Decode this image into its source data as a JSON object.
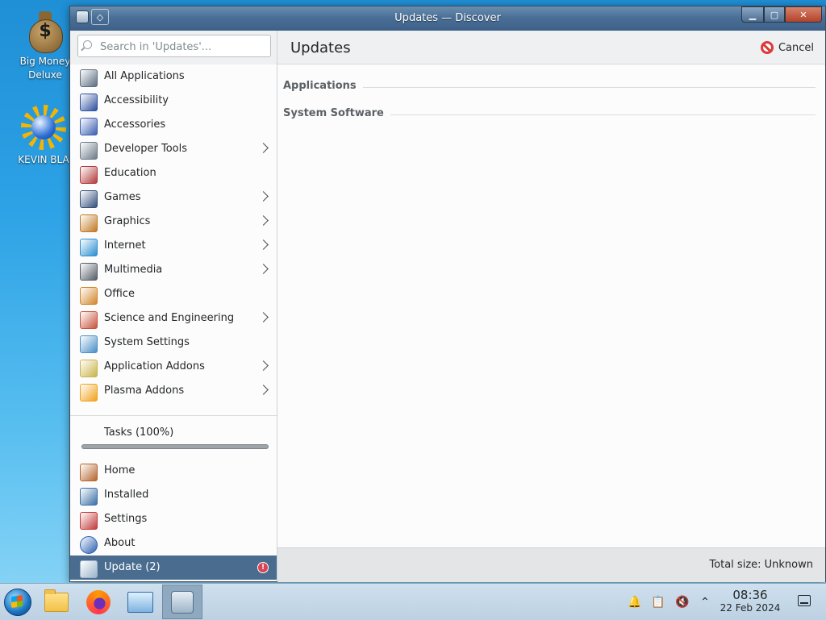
{
  "desktop": {
    "icons": [
      {
        "label": "Big Money\nDeluxe",
        "label_line1": "Big Money",
        "label_line2": "Deluxe"
      },
      {
        "label": "KEVIN BLA"
      }
    ]
  },
  "window": {
    "title": "Updates — Discover",
    "buttons": {
      "minimize": "▁",
      "maximize": "▢",
      "close": "✕"
    }
  },
  "sidebar": {
    "search_placeholder": "Search in 'Updates'...",
    "categories": [
      {
        "label": "All Applications",
        "icon": "all-applications-icon",
        "color": "#5b6e80",
        "submenu": false
      },
      {
        "label": "Accessibility",
        "icon": "accessibility-icon",
        "color": "#2d4f9e",
        "submenu": false
      },
      {
        "label": "Accessories",
        "icon": "accessories-icon",
        "color": "#3a5fb0",
        "submenu": false
      },
      {
        "label": "Developer Tools",
        "icon": "developer-tools-icon",
        "color": "#6c7a87",
        "submenu": true
      },
      {
        "label": "Education",
        "icon": "education-icon",
        "color": "#b23b3b",
        "submenu": false
      },
      {
        "label": "Games",
        "icon": "games-icon",
        "color": "#33507a",
        "submenu": true
      },
      {
        "label": "Graphics",
        "icon": "graphics-icon",
        "color": "#c07a24",
        "submenu": true
      },
      {
        "label": "Internet",
        "icon": "internet-icon",
        "color": "#2a8fd0",
        "submenu": true
      },
      {
        "label": "Multimedia",
        "icon": "multimedia-icon",
        "color": "#555d66",
        "submenu": true
      },
      {
        "label": "Office",
        "icon": "office-icon",
        "color": "#d1872c",
        "submenu": false
      },
      {
        "label": "Science and Engineering",
        "icon": "science-icon",
        "color": "#c7543c",
        "submenu": true
      },
      {
        "label": "System Settings",
        "icon": "system-settings-icon",
        "color": "#4a8fc7",
        "submenu": false
      },
      {
        "label": "Application Addons",
        "icon": "application-addons-icon",
        "color": "#c9b44a",
        "submenu": true
      },
      {
        "label": "Plasma Addons",
        "icon": "plasma-addons-icon",
        "color": "#f0a21b",
        "submenu": true
      }
    ],
    "tasks": {
      "label": "Tasks (100%)",
      "progress": 100
    },
    "nav": [
      {
        "label": "Home",
        "icon": "home-icon",
        "color": "#b5652e"
      },
      {
        "label": "Installed",
        "icon": "installed-icon",
        "color": "#3b6fa6"
      },
      {
        "label": "Settings",
        "icon": "settings-icon",
        "color": "#c23b3b"
      },
      {
        "label": "About",
        "icon": "about-icon",
        "color": "#2a5fb0"
      },
      {
        "label": "Update (2)",
        "icon": "update-icon",
        "color": "#9bb4cc",
        "badge": "!"
      }
    ]
  },
  "main": {
    "title": "Updates",
    "cancel_label": "Cancel",
    "sections": [
      "Applications",
      "System Software"
    ],
    "total_size": "Total size: Unknown"
  },
  "taskbar": {
    "clock_time": "08:36",
    "clock_date": "22 Feb 2024",
    "pinned": [
      "start-orb-icon",
      "folder-icon",
      "firefox-icon",
      "system-settings-icon",
      "discover-icon"
    ],
    "tray": [
      "notification-bell-icon",
      "clipboard-icon",
      "volume-muted-icon",
      "chevron-up-icon"
    ],
    "tray_glyphs": {
      "notify": "🔔",
      "clipboard": "📋",
      "volume": "🔇",
      "arrow": "⌃"
    }
  },
  "colors": {
    "accent": "#4a6d8f",
    "window_bg": "#eff0f1",
    "content_bg": "#fcfcfc",
    "danger": "#da4453"
  }
}
